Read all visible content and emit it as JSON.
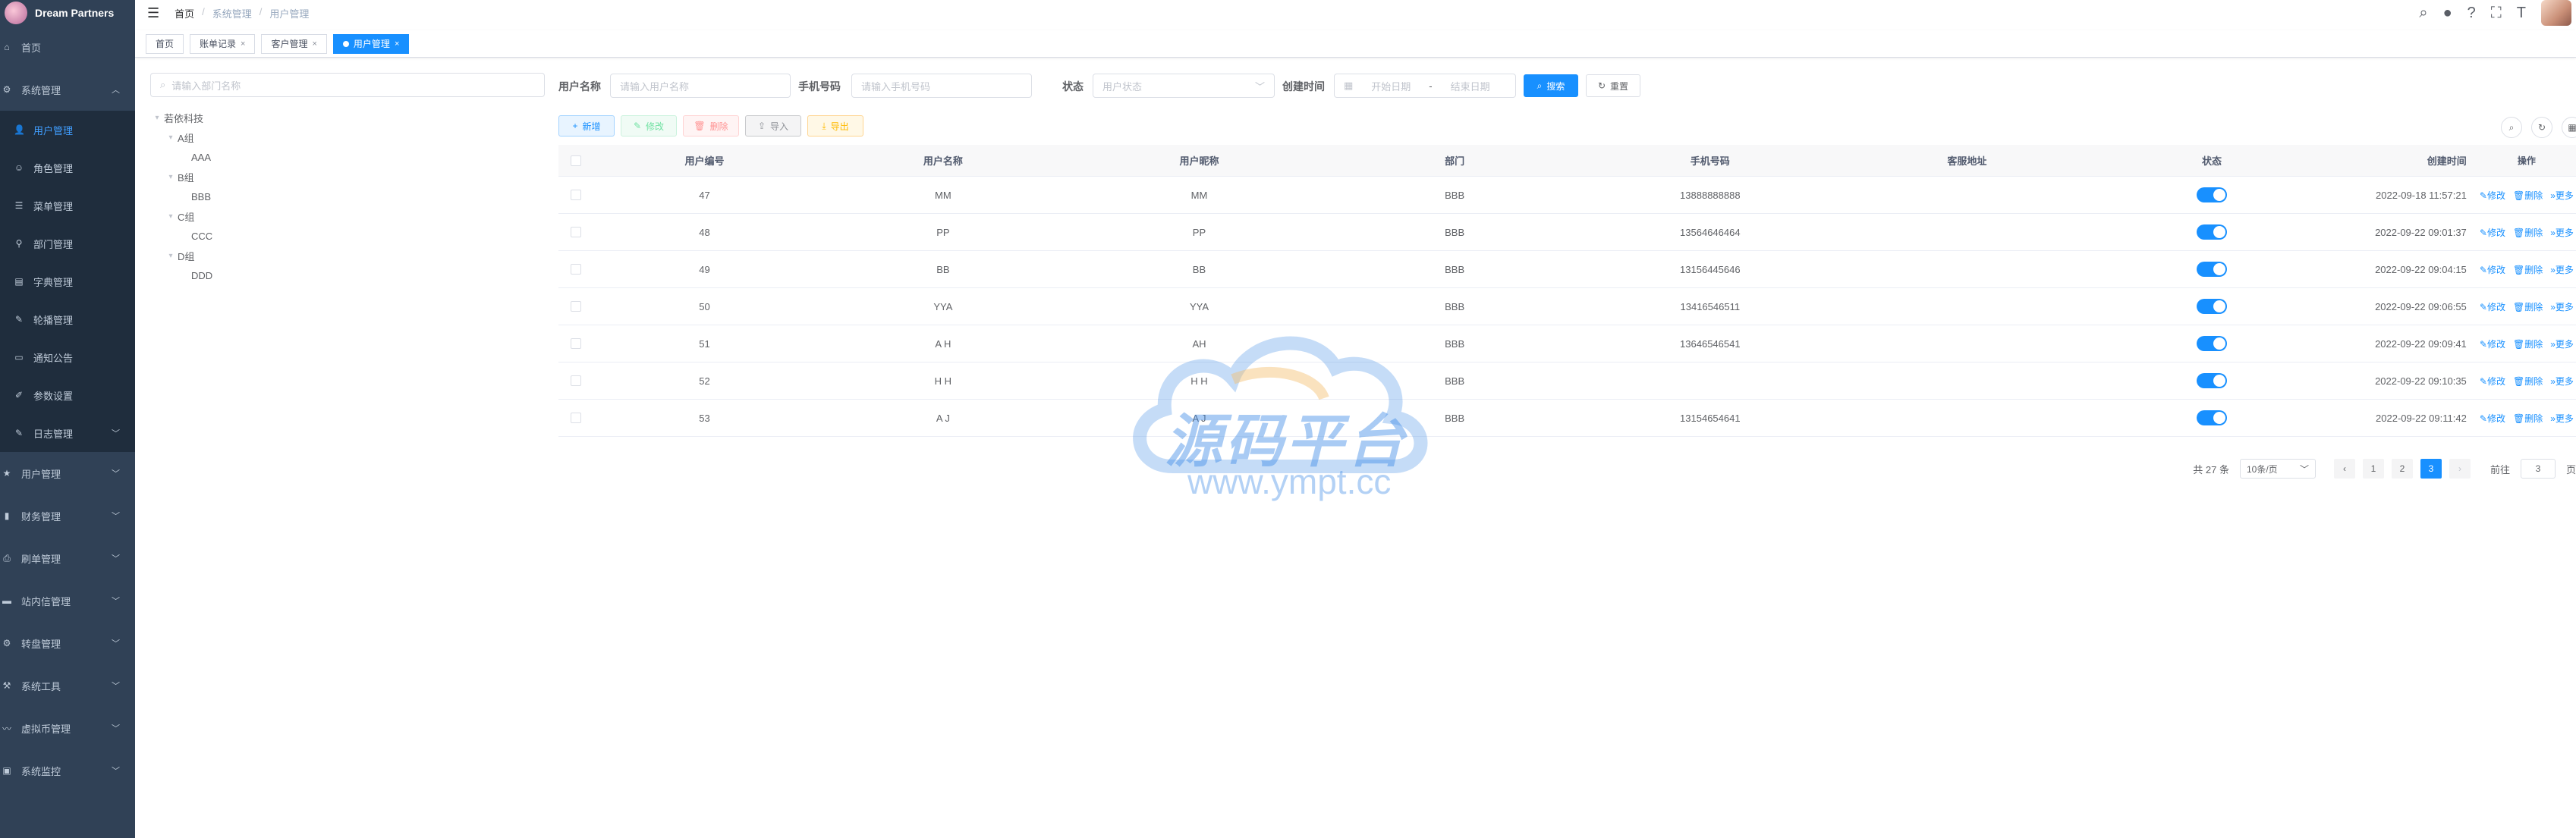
{
  "app": {
    "name": "Dream Partners"
  },
  "sidebar": {
    "items": [
      {
        "label": "首页",
        "icon": "home-icon"
      },
      {
        "label": "系统管理",
        "icon": "gear-icon",
        "expanded": true,
        "children": [
          {
            "label": "用户管理",
            "icon": "user-icon",
            "active": true
          },
          {
            "label": "角色管理",
            "icon": "role-icon"
          },
          {
            "label": "菜单管理",
            "icon": "menu-list-icon"
          },
          {
            "label": "部门管理",
            "icon": "tree-icon"
          },
          {
            "label": "字典管理",
            "icon": "dict-icon"
          },
          {
            "label": "轮播管理",
            "icon": "carousel-icon"
          },
          {
            "label": "通知公告",
            "icon": "message-icon"
          },
          {
            "label": "参数设置",
            "icon": "edit-icon"
          },
          {
            "label": "日志管理",
            "icon": "log-icon"
          }
        ]
      },
      {
        "label": "用户管理",
        "icon": "star-icon"
      },
      {
        "label": "财务管理",
        "icon": "chart-icon"
      },
      {
        "label": "刷单管理",
        "icon": "print-icon"
      },
      {
        "label": "站内信管理",
        "icon": "folder-icon"
      },
      {
        "label": "转盘管理",
        "icon": "gear-icon"
      },
      {
        "label": "系统工具",
        "icon": "tool-icon"
      },
      {
        "label": "虚拟币管理",
        "icon": "coin-icon"
      },
      {
        "label": "系统监控",
        "icon": "monitor-icon"
      }
    ]
  },
  "breadcrumb": [
    "首页",
    "系统管理",
    "用户管理"
  ],
  "tags": [
    {
      "label": "首页",
      "closable": false,
      "active": false
    },
    {
      "label": "账单记录",
      "closable": true,
      "active": false
    },
    {
      "label": "客户管理",
      "closable": true,
      "active": false
    },
    {
      "label": "用户管理",
      "closable": true,
      "active": true
    }
  ],
  "dept_tree": {
    "search_placeholder": "请输入部门名称",
    "nodes": [
      {
        "label": "若依科技",
        "level": 0
      },
      {
        "label": "A组",
        "level": 1
      },
      {
        "label": "AAA",
        "level": 2
      },
      {
        "label": "B组",
        "level": 1
      },
      {
        "label": "BBB",
        "level": 2
      },
      {
        "label": "C组",
        "level": 1
      },
      {
        "label": "CCC",
        "level": 2
      },
      {
        "label": "D组",
        "level": 1
      },
      {
        "label": "DDD",
        "level": 2
      }
    ]
  },
  "search": {
    "username_label": "用户名称",
    "username_placeholder": "请输入用户名称",
    "phone_label": "手机号码",
    "phone_placeholder": "请输入手机号码",
    "status_label": "状态",
    "status_placeholder": "用户状态",
    "time_label": "创建时间",
    "start_placeholder": "开始日期",
    "range_sep": "-",
    "end_placeholder": "结束日期",
    "search_button": "搜索",
    "reset_button": "重置"
  },
  "toolbar": {
    "add": "新增",
    "edit": "修改",
    "delete": "删除",
    "import": "导入",
    "export": "导出"
  },
  "table": {
    "headers": [
      "用户编号",
      "用户名称",
      "用户昵称",
      "部门",
      "手机号码",
      "客服地址",
      "状态",
      "创建时间",
      "操作"
    ],
    "ops": [
      "修改",
      "删除",
      "更多"
    ],
    "rows": [
      {
        "id": "47",
        "name": "MM",
        "nick": "MM",
        "dept": "BBB",
        "phone": "13888888888",
        "addr": "",
        "status": true,
        "time": "2022-09-18 11:57:21"
      },
      {
        "id": "48",
        "name": "PP",
        "nick": "PP",
        "dept": "BBB",
        "phone": "13564646464",
        "addr": "",
        "status": true,
        "time": "2022-09-22 09:01:37"
      },
      {
        "id": "49",
        "name": "BB",
        "nick": "BB",
        "dept": "BBB",
        "phone": "13156445646",
        "addr": "",
        "status": true,
        "time": "2022-09-22 09:04:15"
      },
      {
        "id": "50",
        "name": "YYA",
        "nick": "YYA",
        "dept": "BBB",
        "phone": "13416546511",
        "addr": "",
        "status": true,
        "time": "2022-09-22 09:06:55"
      },
      {
        "id": "51",
        "name": "A H",
        "nick": "AH",
        "dept": "BBB",
        "phone": "13646546541",
        "addr": "",
        "status": true,
        "time": "2022-09-22 09:09:41"
      },
      {
        "id": "52",
        "name": "H H",
        "nick": "H H",
        "dept": "BBB",
        "phone": "",
        "addr": "",
        "status": true,
        "time": "2022-09-22 09:10:35"
      },
      {
        "id": "53",
        "name": "A J",
        "nick": "A J",
        "dept": "BBB",
        "phone": "13154654641",
        "addr": "",
        "status": true,
        "time": "2022-09-22 09:11:42"
      }
    ]
  },
  "pagination": {
    "total_text": "共 27 条",
    "page_size": "10条/页",
    "pages": [
      "1",
      "2",
      "3"
    ],
    "current": "3",
    "goto_label": "前往",
    "goto_value": "3",
    "goto_suffix": "页"
  },
  "watermark": {
    "text": "源码平台",
    "url": "www.ympt.cc"
  },
  "colors": {
    "sidebar_bg": "#304156",
    "primary": "#1890ff",
    "active_menu": "#409eff"
  }
}
